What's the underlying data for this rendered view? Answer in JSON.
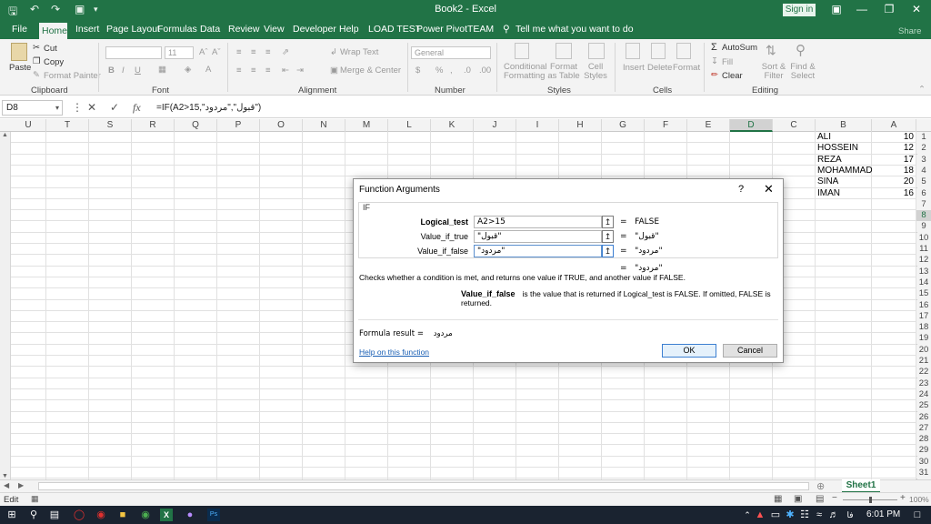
{
  "titlebar": {
    "title": "Book2  -  Excel",
    "signin": "Sign in",
    "quick_access": [
      "save-icon",
      "undo-icon",
      "redo-icon",
      "camera-icon",
      "customize-icon"
    ]
  },
  "ribbon_tabs": [
    "File",
    "Home",
    "Insert",
    "Page Layout",
    "Formulas",
    "Data",
    "Review",
    "View",
    "Developer",
    "Help",
    "LOAD TEST",
    "Power Pivot",
    "TEAM"
  ],
  "tell_me": "Tell me what you want to do",
  "share": "Share",
  "ribbon": {
    "clipboard": {
      "paste": "Paste",
      "cut": "Cut",
      "copy": "Copy",
      "format_painter": "Format Painter",
      "label": "Clipboard"
    },
    "font": {
      "size": "11",
      "label": "Font",
      "bold": "B",
      "italic": "I",
      "underline": "U"
    },
    "alignment": {
      "wrap": "Wrap Text",
      "merge": "Merge & Center",
      "label": "Alignment"
    },
    "number": {
      "format": "General",
      "label": "Number",
      "currency": "$",
      "percent": "%"
    },
    "styles": {
      "conditional": "Conditional Formatting",
      "format_table": "Format as Table",
      "cell_styles": "Cell Styles",
      "label": "Styles"
    },
    "cells": {
      "insert": "Insert",
      "delete": "Delete",
      "format": "Format",
      "label": "Cells"
    },
    "editing": {
      "autosum": "AutoSum",
      "fill": "Fill",
      "clear": "Clear",
      "sort": "Sort & Filter",
      "find": "Find & Select",
      "label": "Editing"
    }
  },
  "formula_bar": {
    "name_box": "D8",
    "formula": "=IF(A2>15,\"قبول\",\"مردود\")",
    "fx": "fx"
  },
  "columns": [
    "U",
    "T",
    "S",
    "R",
    "Q",
    "P",
    "O",
    "N",
    "M",
    "L",
    "K",
    "J",
    "I",
    "H",
    "G",
    "F",
    "E",
    "D",
    "C",
    "B",
    "A"
  ],
  "selected_column": "D",
  "rows": [
    "1",
    "2",
    "3",
    "4",
    "5",
    "6",
    "7",
    "8",
    "9",
    "10",
    "11",
    "12",
    "13",
    "14",
    "15",
    "16",
    "17",
    "18",
    "19",
    "20",
    "21",
    "22",
    "23",
    "24",
    "25",
    "26",
    "27",
    "28",
    "29",
    "30",
    "31"
  ],
  "selected_row": "8",
  "cells": [
    {
      "b": "ALI",
      "a": "10"
    },
    {
      "b": "HOSSEIN",
      "a": "12"
    },
    {
      "b": "REZA",
      "a": "17"
    },
    {
      "b": "MOHAMMAD",
      "a": "18"
    },
    {
      "b": "SINA",
      "a": "20"
    },
    {
      "b": "IMAN",
      "a": "16"
    }
  ],
  "sheet_tab": "Sheet1",
  "status": {
    "mode": "Edit",
    "zoom": "100%"
  },
  "taskbar": {
    "time": "6:01 PM",
    "lang": "فا"
  },
  "dialog": {
    "title": "Function Arguments",
    "help": "?",
    "group": "IF",
    "args": [
      {
        "label": "Logical_test",
        "value": "A2>15",
        "result": "FALSE",
        "bold": true
      },
      {
        "label": "Value_if_true",
        "value": "\"قبول\"",
        "result": "\"قبول\"",
        "bold": false
      },
      {
        "label": "Value_if_false",
        "value": "\"مردود\"",
        "result": "\"مردود\"",
        "bold": false
      }
    ],
    "overall_result": "\"مردود\"",
    "description": "Checks whether a condition is met, and returns one value if TRUE, and another value if FALSE.",
    "arg_help_name": "Value_if_false",
    "arg_help_text": "is the value that is returned if Logical_test is FALSE. If omitted, FALSE is returned.",
    "formula_result_label": "Formula result =",
    "formula_result_value": "مردود",
    "help_link": "Help on this function",
    "ok": "OK",
    "cancel": "Cancel",
    "equals": "="
  }
}
